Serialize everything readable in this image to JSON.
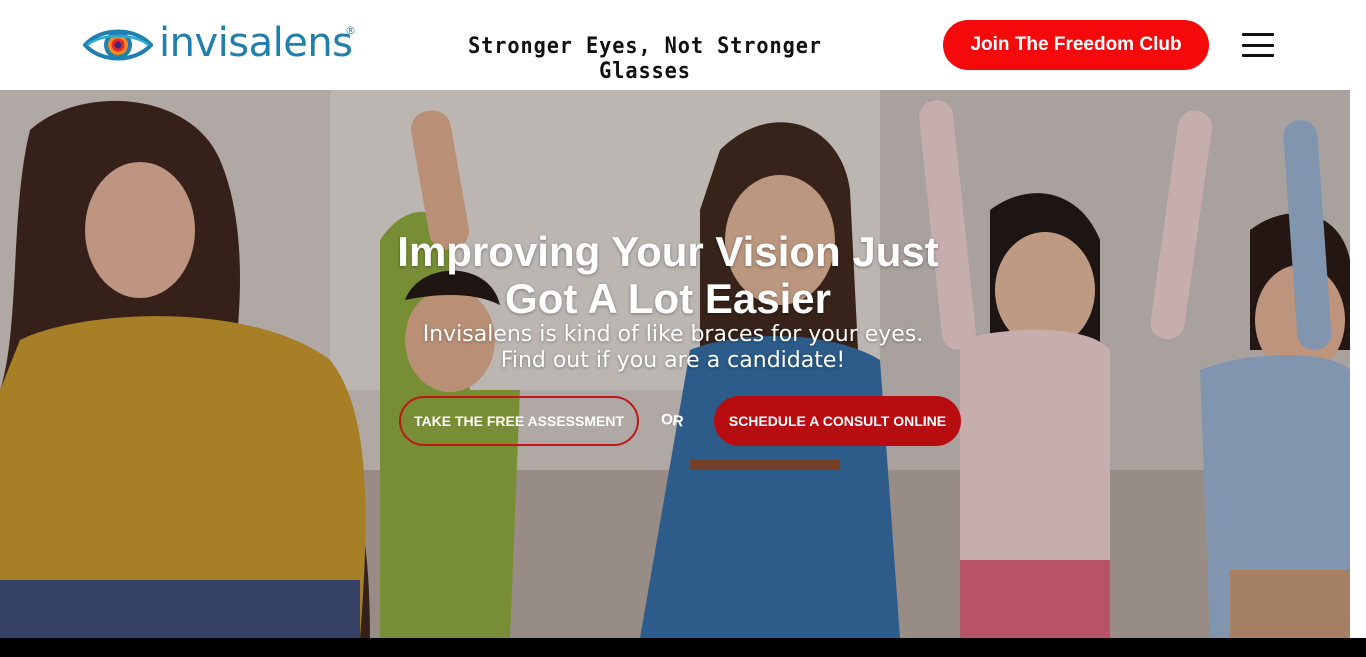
{
  "header": {
    "logo_text": "invisalens",
    "logo_reg": "®",
    "tagline": "Stronger Eyes, Not Stronger Glasses",
    "cta_label": "Join The Freedom Club",
    "menu_icon": "hamburger-icon"
  },
  "hero": {
    "title_line1": "Improving Your Vision Just",
    "title_line2": "Got A Lot Easier",
    "subtitle_line1": "Invisalens is kind of like braces for your eyes.",
    "subtitle_line2": "Find out if you are a candidate!",
    "assessment_label": "TAKE THE FREE ASSESSMENT",
    "or_label": "OR",
    "consult_label": "SCHEDULE A CONSULT ONLINE"
  },
  "colors": {
    "brand_blue": "#1f7fae",
    "cta_red": "#f40a0a",
    "consult_red": "#b80d10",
    "assessment_border": "#c0161a"
  }
}
